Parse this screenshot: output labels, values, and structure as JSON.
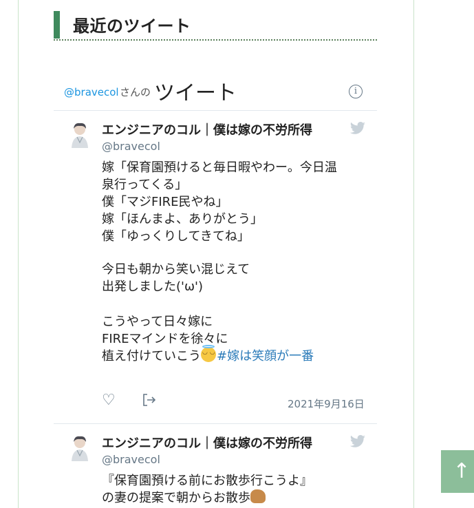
{
  "widget": {
    "title": "最近のツイート"
  },
  "timeline": {
    "handle": "@bravecol",
    "san_no": "さんの",
    "tweet_word": "ツイート",
    "info_icon": "info-icon"
  },
  "tweets": [
    {
      "author": "エンジニアのコル｜僕は嫁の不労所得",
      "screen_name": "@bravecol",
      "lines": [
        "嫁「保育園預けると毎日暇やわー。今日温",
        "泉行ってくる」",
        "僕「マジFIRE民やね」",
        "嫁「ほんまよ、ありがとう」",
        "僕「ゆっくりしてきてね」",
        "",
        "今日も朝から笑い混じえて",
        "出発しました('ω')",
        "",
        "こうやって日々嫁に",
        "FIREマインドを徐々に",
        "植え付けていこう"
      ],
      "hashtag": "#嫁は笑顔が一番",
      "date": "2021年9月16日"
    },
    {
      "author": "エンジニアのコル｜僕は嫁の不労所得",
      "screen_name": "@bravecol",
      "lines": [
        "『保育園預ける前にお散歩行こうよ』",
        "の妻の提案で朝からお散歩"
      ]
    }
  ],
  "icons": {
    "bird": "twitter-bird-icon",
    "heart": "heart-icon",
    "share": "share-icon",
    "scroll_top": "arrow-up-icon"
  },
  "colors": {
    "accent_green": "#3f8a5d",
    "link_blue": "#1b95e0",
    "hashtag_blue": "#2b7bb9",
    "muted_gray": "#657786",
    "top_button": "#8cbe9a"
  },
  "scroll_top_label": "↑"
}
